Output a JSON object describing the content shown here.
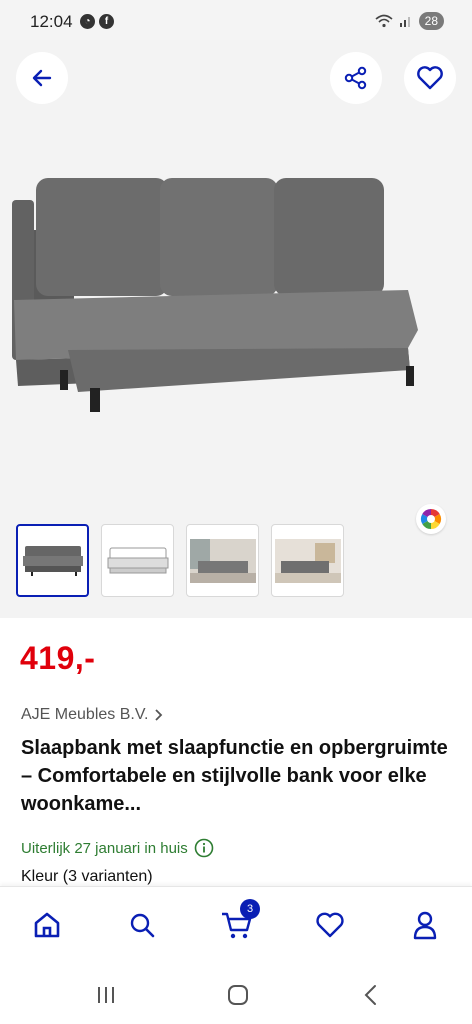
{
  "status_bar": {
    "time": "12:04",
    "battery": "28",
    "icons": [
      "notification-app-icon",
      "facebook-icon",
      "wifi-icon",
      "signal-icon"
    ]
  },
  "hero": {
    "back_icon": "arrow-left-icon",
    "share_icon": "share-icon",
    "favorite_icon": "heart-outline-icon",
    "color_variants_icon": "color-wheel-icon",
    "thumbnails": [
      "sofa-front",
      "sofa-sketch",
      "sofa-room-1",
      "sofa-room-2"
    ],
    "active_thumbnail": 0
  },
  "product": {
    "price": "419,-",
    "seller": "AJE Meubles B.V.",
    "title": "Slaapbank met slaapfunctie en opbergruimte – Comfortabele en stijlvolle bank voor elke woonkame...",
    "delivery": "Uiterlijk 27 januari in huis",
    "variant_label": "Kleur (3 varianten)"
  },
  "bottom_nav": {
    "items": [
      "home-icon",
      "search-icon",
      "cart-icon",
      "heart-icon",
      "account-icon"
    ],
    "cart_count": "3",
    "accent": "#0a1fb4"
  },
  "system_nav": [
    "recent-apps-icon",
    "home-button-icon",
    "back-icon"
  ],
  "colors": {
    "price": "#e0000b",
    "delivery": "#2e7d32",
    "brand": "#0a1fb4"
  }
}
